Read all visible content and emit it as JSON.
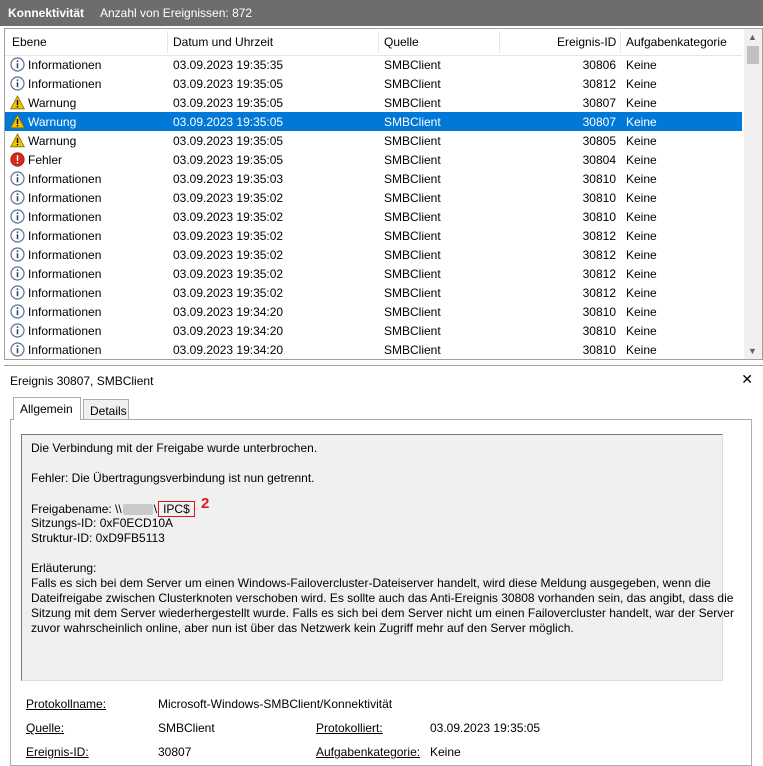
{
  "topbar": {
    "title": "Konnektivität",
    "count_text": "Anzahl von Ereignissen: 872"
  },
  "columns": {
    "level": "Ebene",
    "datetime": "Datum und Uhrzeit",
    "source": "Quelle",
    "id": "Ereignis-ID",
    "task": "Aufgabenkategorie"
  },
  "rows": [
    {
      "level": "Informationen",
      "icon": "info-icon",
      "datetime": "03.09.2023 19:35:35",
      "source": "SMBClient",
      "id": "30806",
      "task": "Keine"
    },
    {
      "level": "Informationen",
      "icon": "info-icon",
      "datetime": "03.09.2023 19:35:05",
      "source": "SMBClient",
      "id": "30812",
      "task": "Keine"
    },
    {
      "level": "Warnung",
      "icon": "warning-icon",
      "datetime": "03.09.2023 19:35:05",
      "source": "SMBClient",
      "id": "30807",
      "task": "Keine"
    },
    {
      "level": "Warnung",
      "icon": "warning-icon",
      "datetime": "03.09.2023 19:35:05",
      "source": "SMBClient",
      "id": "30807",
      "task": "Keine",
      "selected": true
    },
    {
      "level": "Warnung",
      "icon": "warning-icon",
      "datetime": "03.09.2023 19:35:05",
      "source": "SMBClient",
      "id": "30805",
      "task": "Keine"
    },
    {
      "level": "Fehler",
      "icon": "error-icon",
      "datetime": "03.09.2023 19:35:05",
      "source": "SMBClient",
      "id": "30804",
      "task": "Keine"
    },
    {
      "level": "Informationen",
      "icon": "info-icon",
      "datetime": "03.09.2023 19:35:03",
      "source": "SMBClient",
      "id": "30810",
      "task": "Keine"
    },
    {
      "level": "Informationen",
      "icon": "info-icon",
      "datetime": "03.09.2023 19:35:02",
      "source": "SMBClient",
      "id": "30810",
      "task": "Keine"
    },
    {
      "level": "Informationen",
      "icon": "info-icon",
      "datetime": "03.09.2023 19:35:02",
      "source": "SMBClient",
      "id": "30810",
      "task": "Keine"
    },
    {
      "level": "Informationen",
      "icon": "info-icon",
      "datetime": "03.09.2023 19:35:02",
      "source": "SMBClient",
      "id": "30812",
      "task": "Keine"
    },
    {
      "level": "Informationen",
      "icon": "info-icon",
      "datetime": "03.09.2023 19:35:02",
      "source": "SMBClient",
      "id": "30812",
      "task": "Keine"
    },
    {
      "level": "Informationen",
      "icon": "info-icon",
      "datetime": "03.09.2023 19:35:02",
      "source": "SMBClient",
      "id": "30812",
      "task": "Keine"
    },
    {
      "level": "Informationen",
      "icon": "info-icon",
      "datetime": "03.09.2023 19:35:02",
      "source": "SMBClient",
      "id": "30812",
      "task": "Keine"
    },
    {
      "level": "Informationen",
      "icon": "info-icon",
      "datetime": "03.09.2023 19:34:20",
      "source": "SMBClient",
      "id": "30810",
      "task": "Keine"
    },
    {
      "level": "Informationen",
      "icon": "info-icon",
      "datetime": "03.09.2023 19:34:20",
      "source": "SMBClient",
      "id": "30810",
      "task": "Keine"
    },
    {
      "level": "Informationen",
      "icon": "info-icon",
      "datetime": "03.09.2023 19:34:20",
      "source": "SMBClient",
      "id": "30810",
      "task": "Keine"
    }
  ],
  "detail": {
    "title": "Ereignis 30807, SMBClient",
    "close": "✕",
    "tabs": {
      "general": "Allgemein",
      "details": "Details"
    },
    "desc": {
      "line1": "Die Verbindung mit der Freigabe wurde unterbrochen.",
      "line2": "Fehler: Die Übertragungsverbindung ist nun getrennt.",
      "share_label": "Freigabename: \\\\",
      "share_sep": "\\",
      "share_name": "IPC$",
      "annotation": "2",
      "session": "Sitzungs-ID: 0xF0ECD10A",
      "tree": "Struktur-ID: 0xD9FB5113",
      "expl_title": "Erläuterung:",
      "expl": [
        "Falls es sich bei dem Server um einen Windows-Failovercluster-Dateiserver handelt, wird diese Meldung ausgegeben, wenn die",
        "Dateifreigabe zwischen Clusterknoten verschoben wird. Es sollte auch das Anti-Ereignis 30808 vorhanden sein, das angibt, dass die",
        "Sitzung mit dem Server wiederhergestellt wurde. Falls es sich bei dem Server nicht um einen Failovercluster handelt, war der Server",
        "zuvor wahrscheinlich online, aber nun ist über das Netzwerk kein Zugriff mehr auf den Server möglich."
      ]
    },
    "props": {
      "log_label": "Protokollname:",
      "log_value": "Microsoft-Windows-SMBClient/Konnektivität",
      "source_label": "Quelle:",
      "source_value": "SMBClient",
      "logged_label": "Protokolliert:",
      "logged_value": "03.09.2023 19:35:05",
      "id_label": "Ereignis-ID:",
      "id_value": "30807",
      "task_label": "Aufgabenkategorie:",
      "task_value": "Keine"
    }
  }
}
